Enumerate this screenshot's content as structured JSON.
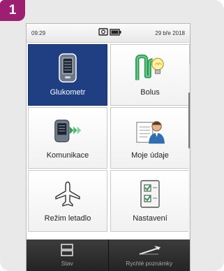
{
  "step": {
    "number": "1"
  },
  "status_bar": {
    "time": "09:29",
    "date": "29 bře 2018"
  },
  "menu": {
    "tiles": [
      {
        "label": "Glukometr",
        "icon": "glucometer-icon",
        "selected": true
      },
      {
        "label": "Bolus",
        "icon": "bolus-icon",
        "selected": false
      },
      {
        "label": "Komunikace",
        "icon": "communication-icon",
        "selected": false
      },
      {
        "label": "Moje údaje",
        "icon": "my-data-icon",
        "selected": false
      },
      {
        "label": "Režim letadlo",
        "icon": "airplane-icon",
        "selected": false
      },
      {
        "label": "Nastavení",
        "icon": "settings-checklist-icon",
        "selected": false
      }
    ]
  },
  "bottom_bar": {
    "status_label": "Stav",
    "quick_notes_label": "Rychlé poznámky"
  },
  "colors": {
    "badge": "#9d1f72",
    "selected_tile": "#1f3f82",
    "bottom_bar": "#2e2e2e"
  }
}
